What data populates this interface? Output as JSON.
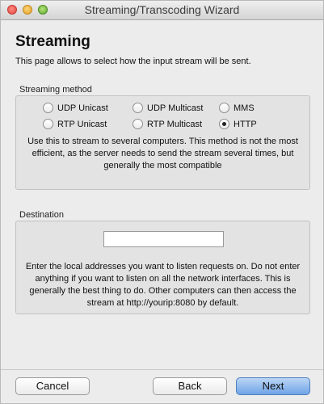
{
  "window": {
    "title": "Streaming/Transcoding Wizard"
  },
  "page": {
    "title": "Streaming",
    "description": "This page allows to select how the input stream will be sent."
  },
  "streaming_method": {
    "label": "Streaming method",
    "options": [
      {
        "label": "UDP Unicast",
        "selected": false
      },
      {
        "label": "UDP Multicast",
        "selected": false
      },
      {
        "label": "MMS",
        "selected": false
      },
      {
        "label": "RTP Unicast",
        "selected": false
      },
      {
        "label": "RTP Multicast",
        "selected": false
      },
      {
        "label": "HTTP",
        "selected": true
      }
    ],
    "description": "Use this to stream to several computers. This method is not the most efficient, as the server needs to send the stream several times, but generally the most compatible"
  },
  "destination": {
    "label": "Destination",
    "value": "",
    "description": "Enter the local addresses you want to listen requests on. Do not enter anything if you want to listen on all the network interfaces. This is generally the best thing to do. Other computers can then access the stream at http://yourip:8080 by default."
  },
  "buttons": {
    "cancel": "Cancel",
    "back": "Back",
    "next": "Next"
  }
}
